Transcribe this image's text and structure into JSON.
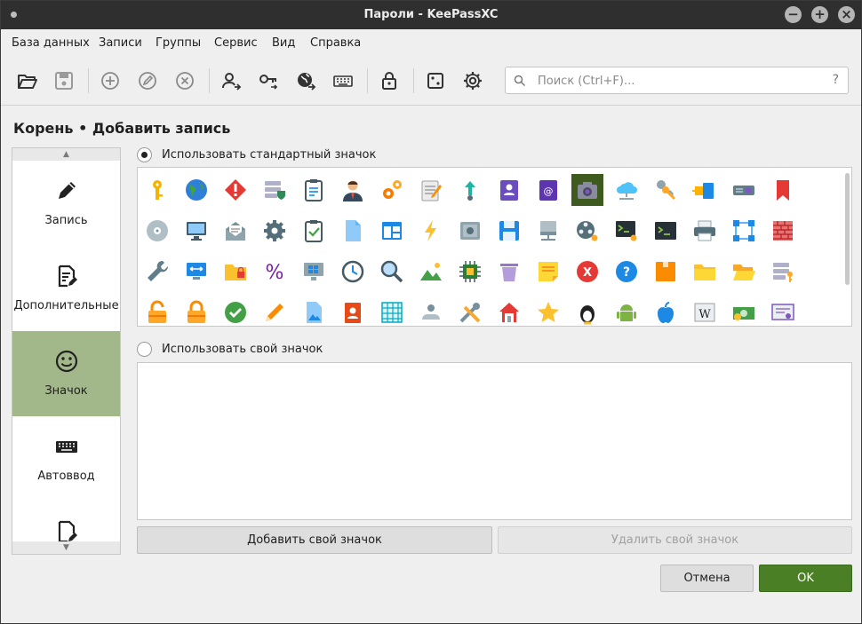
{
  "window": {
    "title": "Пароли - KeePassXC",
    "controls": {
      "minimize": "−",
      "maximize": "+",
      "close": "×"
    }
  },
  "menubar": {
    "items": [
      "База данных",
      "Записи",
      "Группы",
      "Сервис",
      "Вид",
      "Справка"
    ]
  },
  "toolbar": {
    "buttons": [
      "open-database-icon",
      "save-database-icon",
      "add-entry-icon",
      "edit-entry-icon",
      "delete-entry-icon",
      "copy-username-icon",
      "copy-password-icon",
      "open-url-icon",
      "autotype-icon",
      "lock-database-icon",
      "password-generator-icon",
      "settings-icon"
    ]
  },
  "search": {
    "placeholder": "Поиск (Ctrl+F)...",
    "help": "?"
  },
  "page": {
    "title": "Корень • Добавить запись"
  },
  "sidebar": {
    "items": [
      {
        "label": "Запись",
        "icon": "pencil-icon"
      },
      {
        "label": "Дополнительные",
        "icon": "document-edit-icon"
      },
      {
        "label": "Значок",
        "icon": "smiley-icon",
        "active": true
      },
      {
        "label": "Автоввод",
        "icon": "keyboard-icon"
      },
      {
        "label": "",
        "icon": "document-icon"
      }
    ]
  },
  "icons": {
    "use_default_label": "Использовать стандартный значок",
    "use_custom_label": "Использовать свой значок",
    "selected": "use_default",
    "selected_icon_index": 11
  },
  "buttons": {
    "add_custom": "Добавить свой значок",
    "remove_custom": "Удалить свой значок",
    "cancel": "Отмена",
    "ok": "OK"
  },
  "colors": {
    "accent": "#4b7f26",
    "sidebar_active": "#a3b88a",
    "titlebar": "#2f2f2f"
  }
}
